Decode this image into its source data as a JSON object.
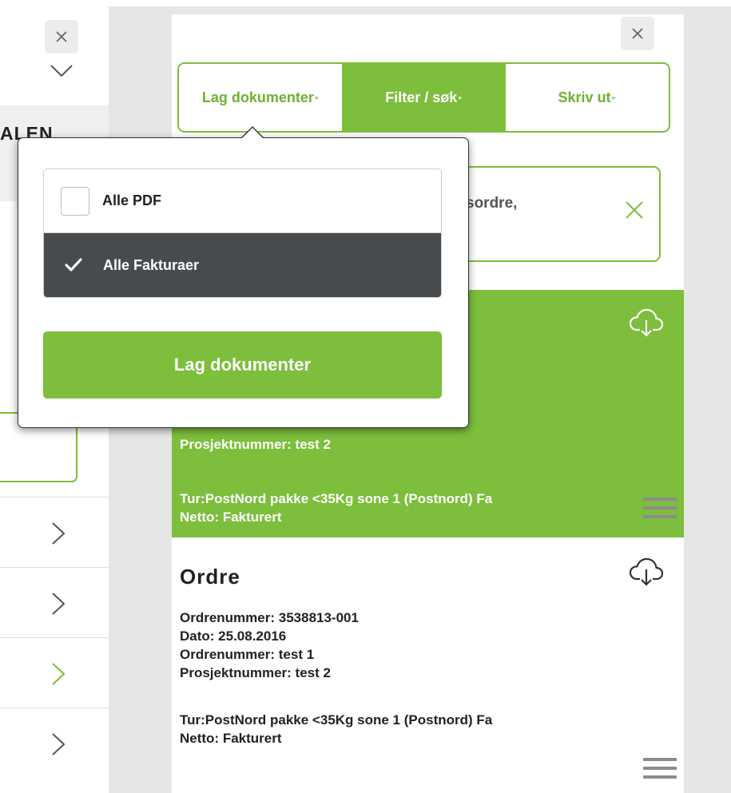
{
  "left_panel": {
    "heading": "ALEN"
  },
  "tabs": [
    {
      "label": "Lag dokumenter",
      "active": false
    },
    {
      "label": "Filter / søk",
      "active": true
    },
    {
      "label": "Skriv ut",
      "active": false
    }
  ],
  "search": {
    "value_fragment": "sordre,"
  },
  "cards": [
    {
      "highlighted": true,
      "project_line": "Prosjektnummer: test 2",
      "tour_line": "Tur:PostNord pakke <35Kg sone 1 (Postnord) Fa",
      "net_line": "Netto: Fakturert"
    },
    {
      "highlighted": false,
      "title": "Ordre",
      "lines": [
        "Ordrenummer: 3538813-001",
        "Dato: 25.08.2016",
        "Ordrenummer: test 1",
        "Prosjektnummer: test 2"
      ],
      "tour_line": "Tur:PostNord pakke <35Kg sone 1 (Postnord) Fa",
      "net_line": "Netto: Fakturert"
    }
  ],
  "popover": {
    "options": [
      {
        "label": "Alle PDF",
        "checked": false
      },
      {
        "label": "Alle Fakturaer",
        "checked": true
      }
    ],
    "button_label": "Lag dokumenter"
  },
  "colors": {
    "accent": "#7dbe3c",
    "selected_option_bg": "#474b4e",
    "backdrop": "#e6e6e6"
  },
  "icons": [
    "close-icon",
    "chevron-down-icon",
    "chevron-right-icon",
    "cloud-download-icon",
    "menu-icon",
    "clear-icon",
    "checkmark-icon"
  ]
}
